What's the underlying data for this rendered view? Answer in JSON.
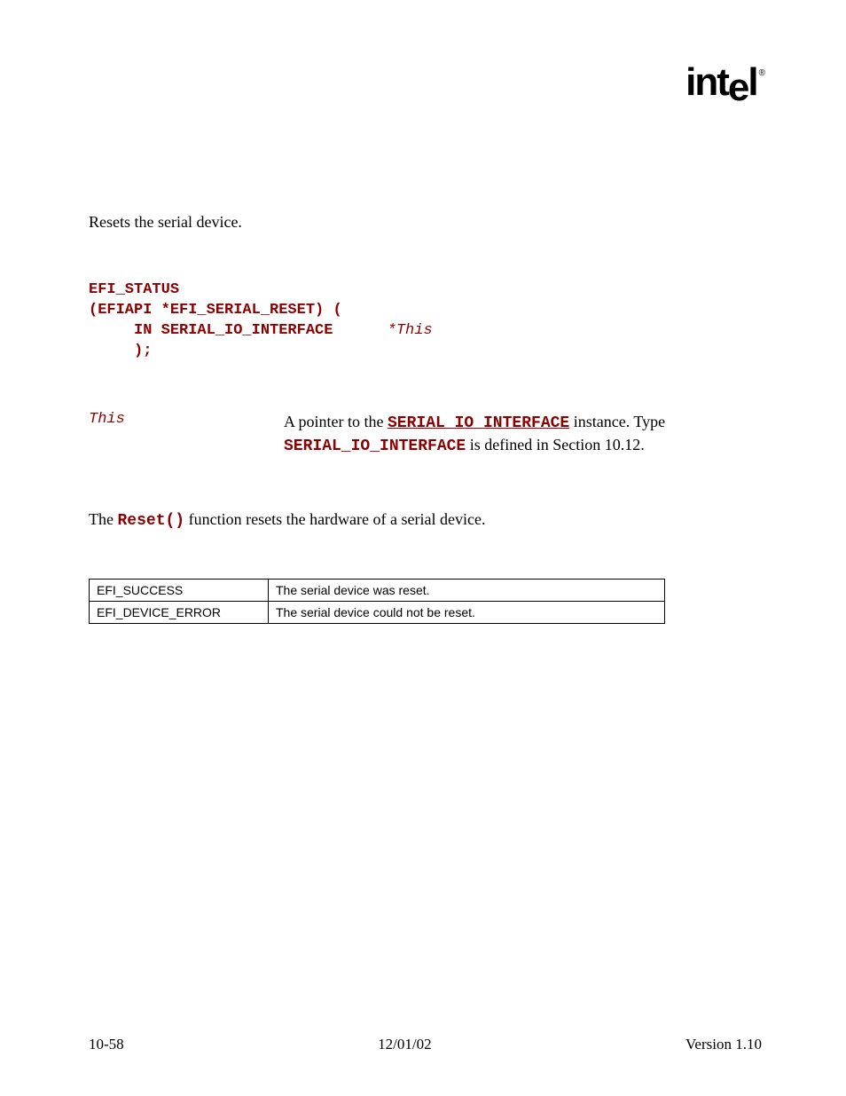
{
  "logo": "intel",
  "summary": "Resets the serial device.",
  "prototype": {
    "line1": "EFI_STATUS",
    "line2": "(EFIAPI *EFI_SERIAL_RESET) (",
    "line3a": "     IN SERIAL_IO_INTERFACE      ",
    "line3b": "*This",
    "line4": "     );"
  },
  "param": {
    "name": "This",
    "desc_pre": "A pointer to the ",
    "desc_link": "SERIAL_IO_INTERFACE",
    "desc_mid": " instance.  Type ",
    "desc_code": "SERIAL_IO_INTERFACE",
    "desc_post": " is defined in Section 10.12."
  },
  "description": {
    "pre": "The ",
    "code": "Reset()",
    "post": " function resets the hardware of a serial device."
  },
  "status": [
    {
      "code": "EFI_SUCCESS",
      "desc": "The serial device was reset."
    },
    {
      "code": "EFI_DEVICE_ERROR",
      "desc": "The serial device could not be reset."
    }
  ],
  "footer": {
    "left": "10-58",
    "center": "12/01/02",
    "right": "Version 1.10"
  }
}
